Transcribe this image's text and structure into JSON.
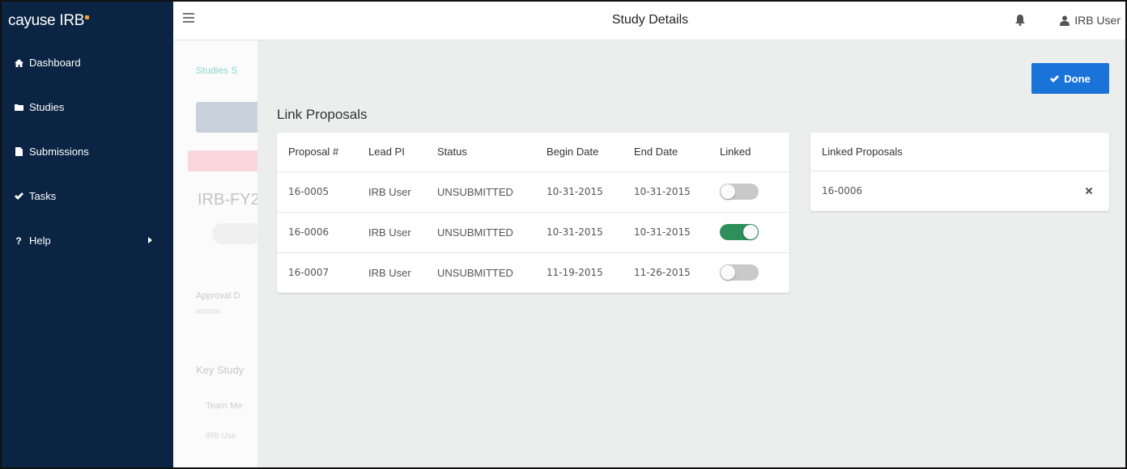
{
  "brand": {
    "name": "cayuse IRB"
  },
  "sidebar": {
    "items": [
      {
        "label": "Dashboard",
        "icon": "home-icon"
      },
      {
        "label": "Studies",
        "icon": "folder-icon"
      },
      {
        "label": "Submissions",
        "icon": "file-icon"
      },
      {
        "label": "Tasks",
        "icon": "check-icon"
      },
      {
        "label": "Help",
        "icon": "question-icon"
      }
    ]
  },
  "topbar": {
    "title": "Study Details",
    "user": "IRB User"
  },
  "background_page": {
    "breadcrumb": "Studies   S",
    "study_id": "IRB-FY2",
    "approval_label": "Approval D",
    "key_label": "Key Study",
    "team_label": "Team Me",
    "user_label": "IRB Use"
  },
  "panel": {
    "done_label": "Done",
    "title": "Link Proposals",
    "columns": [
      "Proposal #",
      "Lead PI",
      "Status",
      "Begin Date",
      "End Date",
      "Linked"
    ],
    "rows": [
      {
        "proposal": "16-0005",
        "lead_pi": "IRB User",
        "status": "UNSUBMITTED",
        "begin": "10-31-2015",
        "end": "10-31-2015",
        "linked": false
      },
      {
        "proposal": "16-0006",
        "lead_pi": "IRB User",
        "status": "UNSUBMITTED",
        "begin": "10-31-2015",
        "end": "10-31-2015",
        "linked": true
      },
      {
        "proposal": "16-0007",
        "lead_pi": "IRB User",
        "status": "UNSUBMITTED",
        "begin": "11-19-2015",
        "end": "11-26-2015",
        "linked": false
      }
    ],
    "linked_title": "Linked Proposals",
    "linked_items": [
      "16-0006"
    ]
  },
  "colors": {
    "sidebar": "#0b2443",
    "accent": "#1a73d9",
    "toggle_on": "#2e8f5a",
    "brand_dot": "#f0a030"
  }
}
